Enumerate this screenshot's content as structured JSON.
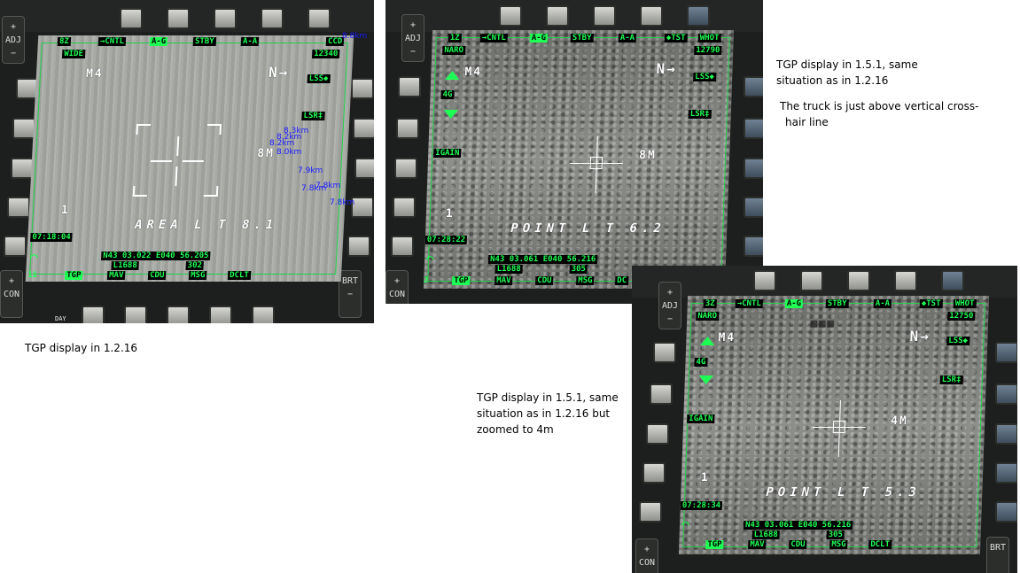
{
  "panel1": {
    "top_left": "8Z",
    "cntl": "→CNTL",
    "ag": "A-G",
    "stby": "STBY",
    "aa": "A-A",
    "ccd": "CCD",
    "wide": "WIDE",
    "alt": "12340",
    "lss": "LSS◆",
    "lsr": "LSR‡",
    "mode": "M4",
    "fov": "8M",
    "num": "1",
    "area": "AREA   L   T   8.1",
    "time": "07:18:04",
    "coords": "N43 03.022 E040 56.205",
    "l_code": "L1688",
    "l_code2": "302",
    "num11": "11",
    "osb_tgp": "TGP",
    "osb_mav": "MAV",
    "osb_cdu": "CDU",
    "osb_msg": "MSG",
    "osb_dclt": "DCLT",
    "adj": "ADJ",
    "con": "CON",
    "brt": "BRT",
    "day": "DAY",
    "blue_labels": [
      "8.8km",
      "8.3km",
      "8.2km",
      "8.2km",
      "8.0km",
      "7.9km",
      "7.8km",
      "7.8km",
      "7.8km"
    ]
  },
  "panel2": {
    "top_left": "1Z",
    "cntl": "→CNTL",
    "ag": "A-G",
    "stby": "STBY",
    "aa": "A-A",
    "tst": "◆TST",
    "whot": "WHOT",
    "naro": "NARO",
    "alt": "12790",
    "lss": "LSS◆",
    "lsr": "LSR‡",
    "mode": "M4",
    "g": "4G",
    "igain": "IGAIN",
    "fov": "8M",
    "num": "1",
    "point": "POINT   L   T   6.2",
    "time": "07:28:22",
    "coords": "N43 03.061 E040 56.216",
    "l_code": "L1688",
    "l_code2": "305",
    "num12": "12",
    "osb_tgp": "TGP",
    "osb_mav": "MAV",
    "osb_cdu": "CDU",
    "osb_msg": "MSG",
    "osb_dclt": "DC",
    "adj": "ADJ",
    "con": "CON"
  },
  "panel3": {
    "top_left": "3Z",
    "cntl": "→CNTL",
    "ag": "A-G",
    "stby": "STBY",
    "aa": "A-A",
    "tst": "◆TST",
    "whot": "WHOT",
    "naro": "NARO",
    "alt": "12750",
    "lss": "LSS◆",
    "lsr": "LSR‡",
    "mode": "M4",
    "g": "4G",
    "igain": "IGAIN",
    "fov": "4M",
    "num": "1",
    "point": "POINT   L   T   5.3",
    "time": "07:28:34",
    "coords": "N43 03.061 E040 56.216",
    "l_code": "L1688",
    "l_code2": "305",
    "num12": "12",
    "osb_tgp": "TGP",
    "osb_mav": "MAV",
    "osb_cdu": "CDU",
    "osb_msg": "MSG",
    "osb_dclt": "DCLT",
    "adj": "ADJ",
    "con": "CON",
    "brt": "BRT"
  },
  "captions": {
    "c1": "TGP display in 1.2.16",
    "c2_line1": "TGP display in 1.5.1, same",
    "c2_line2": "situation as in 1.2.16",
    "c3_line1": "The truck is just above vertical cross-",
    "c3_line2": "hair line",
    "c4_line1": "TGP display in 1.5.1, same",
    "c4_line2": "situation as in 1.2.16 but",
    "c4_line3": "zoomed to 4m"
  }
}
